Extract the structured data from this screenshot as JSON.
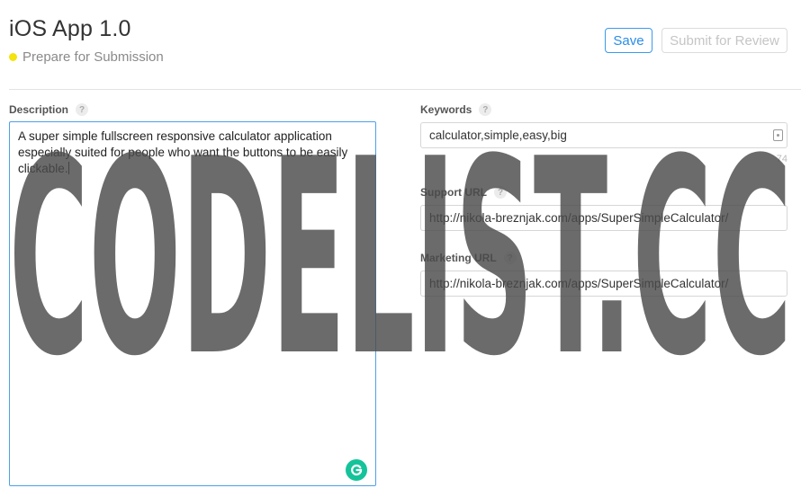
{
  "header": {
    "app_title": "iOS App 1.0",
    "status_text": "Prepare for Submission",
    "status_color": "#f4e30c",
    "save_label": "Save",
    "submit_label": "Submit for Review"
  },
  "description": {
    "label": "Description",
    "help": "?",
    "value": "A super simple fullscreen responsive calculator application especially suited for people who want the buttons to be easily clickable."
  },
  "keywords": {
    "label": "Keywords",
    "help": "?",
    "value": "calculator,simple,easy,big",
    "remaining": "74"
  },
  "support_url": {
    "label": "Support URL",
    "help": "?",
    "value": "http://nikola-breznjak.com/apps/SuperSimpleCalculator/"
  },
  "marketing_url": {
    "label": "Marketing URL",
    "help": "?",
    "value": "http://nikola-breznjak.com/apps/SuperSimpleCalculator/"
  },
  "watermark": {
    "text": "CODELIST.CC"
  },
  "colors": {
    "accent": "#3b99ef",
    "grammarly": "#15c39a"
  },
  "icons": [
    "grammarly-icon",
    "keyboard-icon",
    "help-icon"
  ]
}
